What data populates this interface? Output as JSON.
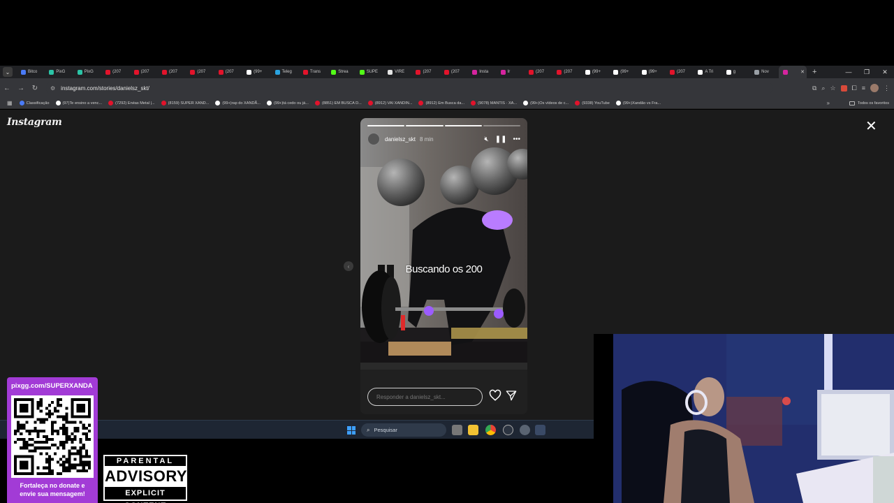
{
  "browser": {
    "tabs": [
      {
        "label": "Bitco",
        "color": "#4a7bf7"
      },
      {
        "label": "PixG",
        "color": "#2bc4a6"
      },
      {
        "label": "PixG",
        "color": "#2bc4a6"
      },
      {
        "label": "(207",
        "color": "#e2132b"
      },
      {
        "label": "(207",
        "color": "#e2132b"
      },
      {
        "label": "(207",
        "color": "#e2132b"
      },
      {
        "label": "(207",
        "color": "#e2132b"
      },
      {
        "label": "(207",
        "color": "#e2132b"
      },
      {
        "label": "(99+",
        "color": "#ffffff"
      },
      {
        "label": "Teleg",
        "color": "#2aa3e0"
      },
      {
        "label": "Trans",
        "color": "#e2132b"
      },
      {
        "label": "Strea",
        "color": "#53fc18"
      },
      {
        "label": "SUPE",
        "color": "#53fc18"
      },
      {
        "label": "VIRE",
        "color": "#e5e5e5"
      },
      {
        "label": "(207",
        "color": "#e2132b"
      },
      {
        "label": "(207",
        "color": "#e2132b"
      },
      {
        "label": "Insta",
        "color": "#d6249f"
      },
      {
        "label": "Ir",
        "color": "#d6249f"
      },
      {
        "label": "(207",
        "color": "#e2132b"
      },
      {
        "label": "(207",
        "color": "#e2132b"
      },
      {
        "label": "(99+",
        "color": "#ffffff"
      },
      {
        "label": "(99+",
        "color": "#ffffff"
      },
      {
        "label": "(99+",
        "color": "#ffffff"
      },
      {
        "label": "(207",
        "color": "#e2132b"
      },
      {
        "label": "A Tri",
        "color": "#ffffff"
      },
      {
        "label": "g",
        "color": "#ffffff"
      },
      {
        "label": "Nov",
        "color": "#9aa0a6"
      },
      {
        "label": "",
        "color": "#d6249f",
        "active": true
      }
    ],
    "url": "instagram.com/stories/danielsz_skt/",
    "bookmarks": [
      {
        "label": "Classificação",
        "color": "#4a7bf7"
      },
      {
        "label": "(97)Te ensino a venc...",
        "color": "#ffffff"
      },
      {
        "label": "(7292) Enéas Metal |...",
        "color": "#e2132b"
      },
      {
        "label": "(8159) SUPER XAND...",
        "color": "#e2132b"
      },
      {
        "label": "(99+)rap do XANDÃ...",
        "color": "#ffffff"
      },
      {
        "label": "(99+)tá cedo ou já...",
        "color": "#ffffff"
      },
      {
        "label": "(8851) EM BUSCA D...",
        "color": "#e2132b"
      },
      {
        "label": "(8912) VAI XANDIN...",
        "color": "#e2132b"
      },
      {
        "label": "(8912) Em Busca da...",
        "color": "#e2132b"
      },
      {
        "label": "(9078) MANTIS · XA...",
        "color": "#e2132b"
      },
      {
        "label": "(99+)Os vídeos de c...",
        "color": "#ffffff"
      },
      {
        "label": "(9338) YouTube",
        "color": "#e2132b"
      },
      {
        "label": "(99+)Xandão vs Fra...",
        "color": "#ffffff"
      }
    ],
    "bookmarks_all": "Todos os favoritos"
  },
  "instagram": {
    "logo": "Instagram",
    "story": {
      "username": "danielsz_skt",
      "time": "8 min",
      "caption": "Buscando os 200",
      "reply_placeholder": "Responder a danielsz_skt...",
      "progress_segments": 4,
      "progress_completed": 3
    }
  },
  "taskbar": {
    "search_label": "Pesquisar"
  },
  "overlay": {
    "qr_url": "pixgg.com/SUPERXANDA",
    "qr_message_line1": "Fortaleça no donate e",
    "qr_message_line2": "envie sua mensagem!",
    "advisory_top": "PARENTAL",
    "advisory_mid": "ADVISORY",
    "advisory_bottom": "EXPLICIT CONTENT"
  }
}
